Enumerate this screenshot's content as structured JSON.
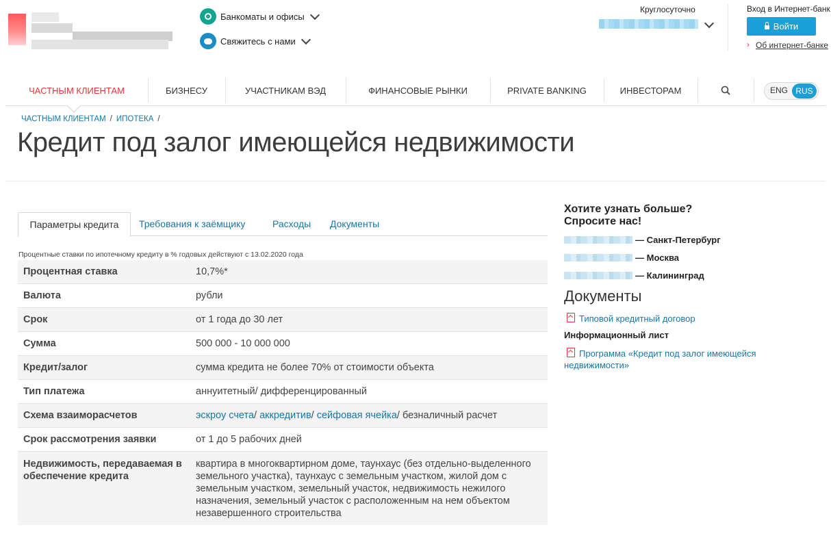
{
  "header": {
    "atm_link": "Банкоматы и офисы",
    "contact_link": "Свяжитесь с нами",
    "hours_label": "Круглосуточно",
    "ibank_label": "Вход в Интернет-банк",
    "login_button": "Войти",
    "about_ibank": "Об интернет-банке"
  },
  "nav": {
    "items": [
      "Частным клиентам",
      "Бизнесу",
      "Участникам ВЭД",
      "Финансовые рынки",
      "Private Banking",
      "Инвесторам"
    ],
    "lang_eng": "ENG",
    "lang_rus": "RUS"
  },
  "breadcrumb": [
    "ЧАСТНЫМ КЛИЕНТАМ",
    "ИПОТЕКА"
  ],
  "page_title": "Кредит под залог имеющейся недвижимости",
  "tabs": [
    "Параметры кредита",
    "Требования к заёмщику",
    "Расходы",
    "Документы"
  ],
  "rate_note": "Процентные ставки по ипотечному кредиту в % годовых действуют с 13.02.2020 года",
  "params": [
    {
      "k": "Процентная ставка",
      "v": "10,7%*"
    },
    {
      "k": "Валюта",
      "v": "рубли"
    },
    {
      "k": "Срок",
      "v": "от 1 года до 30 лет"
    },
    {
      "k": "Сумма",
      "v": "500 000 - 10 000 000"
    },
    {
      "k": "Кредит/залог",
      "v": "сумма кредита не более 70% от стоимости объекта"
    },
    {
      "k": "Тип платежа",
      "v": "аннуитетный/ дифференцированный"
    },
    {
      "k": "Схема взаиморасчетов",
      "links": [
        "эскроу счета",
        "аккредитив",
        "сейфовая ячейка"
      ],
      "tail": "/ безналичный расчет"
    },
    {
      "k": "Срок рассмотрения заявки",
      "v": "от 1 до 5 рабочих дней"
    },
    {
      "k": "Недвижимость, передаваемая в обеспечение кредита",
      "v": "квартира в многоквартирном доме, таунхаус (без отдельно-выделенного земельного участка), таунхаус с земельным участком, жилой дом с земельным участком, земельный участок, недвижимость нежилого назначения, земельный участок с расположенным на нем объектом незавершенного строительства"
    }
  ],
  "sidebar": {
    "question_line1": "Хотите узнать больше?",
    "question_line2": "Спросите нас!",
    "cities": [
      "— Санкт-Петербург",
      "— Москва",
      "— Калининград"
    ],
    "docs_heading": "Документы",
    "doc1": "Типовой кредитный договор",
    "info_heading": "Информационный лист",
    "doc2_line1": "Программа «Кредит под залог имеющейся",
    "doc2_line2": "недвижимости»"
  },
  "colors": {
    "accent": "#1aa0d6",
    "active_nav": "#e1363a",
    "link": "#1577a8"
  }
}
